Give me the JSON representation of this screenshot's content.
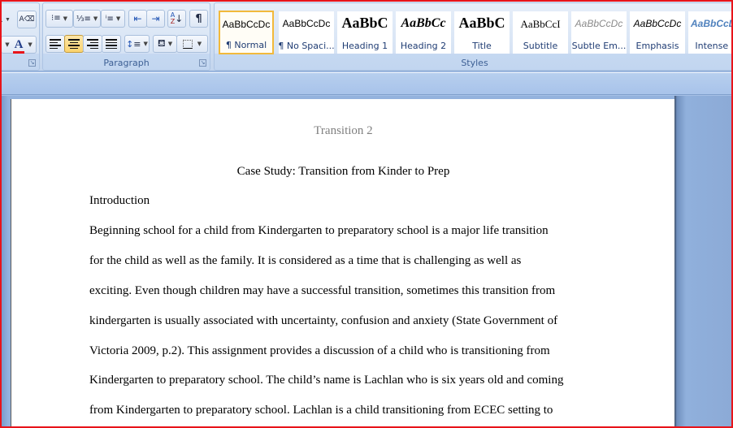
{
  "ribbon": {
    "font_group": {
      "font_color_swatch": "#e8141a"
    },
    "paragraph_group": {
      "label": "Paragraph",
      "buttons": [
        {
          "name": "bullets",
          "glyph": "•≡"
        },
        {
          "name": "numbering",
          "glyph": "1≡"
        },
        {
          "name": "multilevel-list",
          "glyph": "≡"
        },
        {
          "name": "decrease-indent",
          "glyph": "⇤"
        },
        {
          "name": "increase-indent",
          "glyph": "⇥"
        },
        {
          "name": "sort",
          "glyph": "A↓Z"
        },
        {
          "name": "show-hide",
          "glyph": "¶"
        },
        {
          "name": "align-left"
        },
        {
          "name": "align-center",
          "active": true
        },
        {
          "name": "align-right"
        },
        {
          "name": "justify"
        },
        {
          "name": "line-spacing"
        },
        {
          "name": "shading"
        },
        {
          "name": "borders"
        }
      ]
    },
    "styles_group": {
      "label": "Styles",
      "items": [
        {
          "sample": "AaBbCcDc",
          "name": "¶ Normal",
          "selected": true
        },
        {
          "sample": "AaBbCcDc",
          "name": "¶ No Spaci..."
        },
        {
          "sample": "AaBbC",
          "name": "Heading 1"
        },
        {
          "sample": "AaBbCc",
          "name": "Heading 2"
        },
        {
          "sample": "AaBbC",
          "name": "Title"
        },
        {
          "sample": "AaBbCcI",
          "name": "Subtitle"
        },
        {
          "sample": "AaBbCcDc",
          "name": "Subtle Em..."
        },
        {
          "sample": "AaBbCcDc",
          "name": "Emphasis"
        },
        {
          "sample": "AaBbCcDc",
          "name": "Intense E"
        }
      ]
    }
  },
  "document": {
    "header": "Transition 2",
    "title": "Case Study: Transition from Kinder to Prep",
    "lines": [
      "Introduction",
      "Beginning school for a child from Kindergarten to preparatory school is a major life transition",
      "for the child as well as the family.  It is considered as a time that is challenging  as well as",
      "exciting. Even though children may have a successful transition, sometimes this transition  from",
      "kindergarten is usually associated with uncertainty, confusion and anxiety (State Government of",
      "Victoria 2009, p.2). This assignment provides a discussion of a child who is transitioning  from",
      "Kindergarten to preparatory school. The child’s name is Lachlan who is six years old and coming",
      "from Kindergarten to preparatory school.  Lachlan is a child transitioning  from ECEC setting to"
    ]
  }
}
